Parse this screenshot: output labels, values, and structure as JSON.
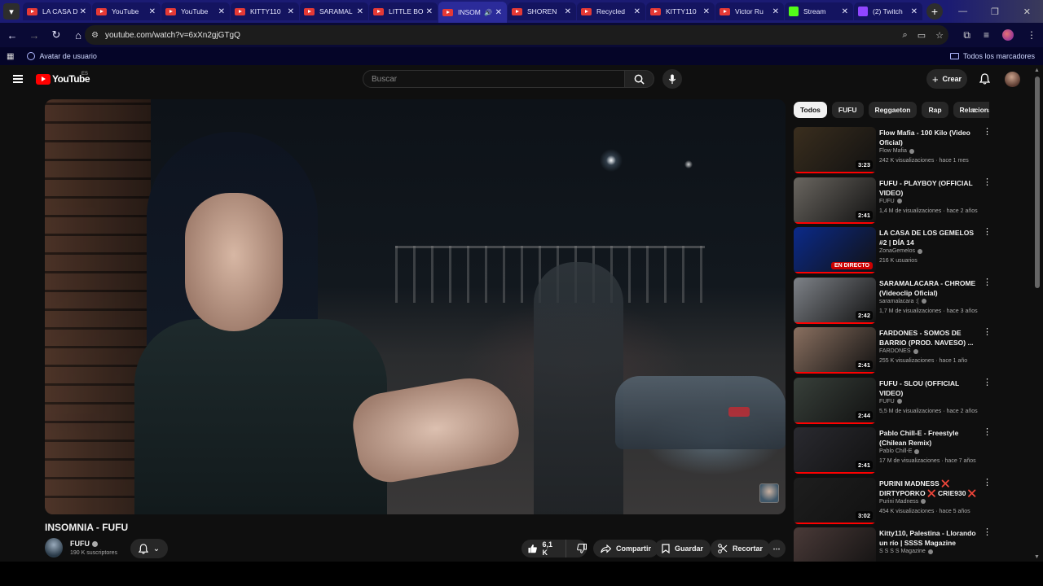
{
  "browser": {
    "tabs": [
      {
        "title": "LA CASA D",
        "kind": "youtube"
      },
      {
        "title": "YouTube",
        "kind": "youtube"
      },
      {
        "title": "YouTube",
        "kind": "youtube"
      },
      {
        "title": "KITTY110",
        "kind": "youtube"
      },
      {
        "title": "SARAMAL",
        "kind": "youtube"
      },
      {
        "title": "LITTLE BO",
        "kind": "youtube"
      },
      {
        "title": "INSOM",
        "kind": "youtube",
        "active": true
      },
      {
        "title": "SHOREN",
        "kind": "youtube"
      },
      {
        "title": "Recycled",
        "kind": "youtube"
      },
      {
        "title": "KITTY110",
        "kind": "youtube"
      },
      {
        "title": "Victor Ru",
        "kind": "youtube"
      },
      {
        "title": "Stream",
        "kind": "kick"
      },
      {
        "title": "(2) Twitch",
        "kind": "twitch"
      }
    ],
    "url": "youtube.com/watch?v=6xXn2gjGTgQ",
    "bookmarks": {
      "item": "Avatar de usuario",
      "all": "Todos los marcadores"
    }
  },
  "masthead": {
    "logo_text": "YouTube",
    "region": "ES",
    "search_placeholder": "Buscar",
    "create_label": "Crear"
  },
  "video": {
    "title": "INSOMNIA - FUFU",
    "channel": "FUFU",
    "subscribers": "190 K suscriptores",
    "likes": "6,1 K",
    "share_label": "Compartir",
    "save_label": "Guardar",
    "clip_label": "Recortar"
  },
  "chips": [
    "Todos",
    "FUFU",
    "Reggaeton",
    "Rap",
    "Relacionado"
  ],
  "recommendations": [
    {
      "title": "Flow Mafia - 100 Kilo (Video Oficial)",
      "channel": "Flow Mafia",
      "meta": "242 K visualizaciones · hace 1 mes",
      "duration": "3:23",
      "thumb": "#3a2e1e"
    },
    {
      "title": "FUFU - PLAYBOY (OFFICIAL VIDEO)",
      "channel": "FUFU",
      "meta": "1,4 M de visualizaciones · hace 2 años",
      "duration": "2:41",
      "thumb": "#6a6660"
    },
    {
      "title": "LA CASA DE LOS GEMELOS #2 | DÍA 14",
      "channel": "ZonaGemelos",
      "meta": "216 K usuarios",
      "live": "EN DIRECTO",
      "thumb": "#0b2a8a"
    },
    {
      "title": "SARAMALACARA - CHROME (Videoclip Oficial)",
      "channel": "saramalacara :(",
      "meta": "1,7 M de visualizaciones · hace 3 años",
      "duration": "2:42",
      "thumb": "#7e8288"
    },
    {
      "title": "FARDONES - SOMOS DE BARRIO (PROD. NAVESO) ...",
      "channel": "FARDONES",
      "meta": "255 K visualizaciones · hace 1 año",
      "duration": "2:41",
      "thumb": "#8a7060"
    },
    {
      "title": "FUFU - SLOU (OFFICIAL VIDEO)",
      "channel": "FUFU",
      "meta": "5,5 M de visualizaciones · hace 2 años",
      "duration": "2:44",
      "thumb": "#38403a"
    },
    {
      "title": "Pablo Chill-E - Freestyle (Chilean Remix)",
      "channel": "Pablo Chill-E",
      "meta": "17 M de visualizaciones · hace 7 años",
      "duration": "2:41",
      "thumb": "#2a2a30"
    },
    {
      "title": "PURINI MADNESS ❌ DIRTYPORKO ❌ CRIE930 ❌ ...",
      "channel": "Purini Madness",
      "meta": "454 K visualizaciones · hace 5 años",
      "duration": "3:02",
      "thumb": "#1e1e1e"
    },
    {
      "title": "Kitty110, Palestina - Llorando un río | SSSS Magazine",
      "channel": "S S S S Magazine",
      "meta": "",
      "duration": "",
      "thumb": "#4a3a38"
    }
  ]
}
